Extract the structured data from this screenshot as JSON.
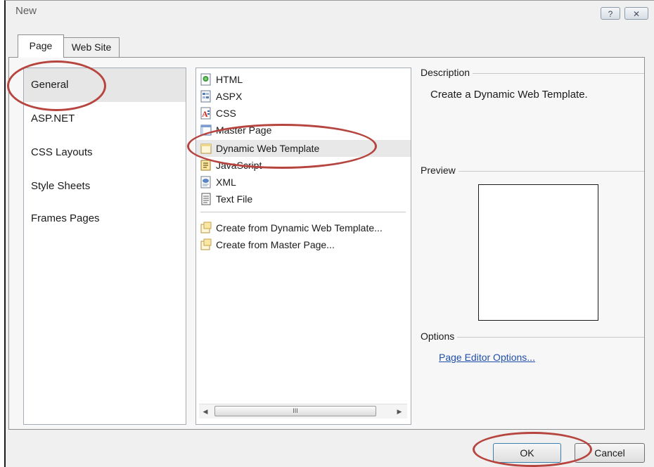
{
  "dialog": {
    "title": "New",
    "help_glyph": "?",
    "close_glyph": "✕"
  },
  "tabs": [
    {
      "label": "Page",
      "active": true
    },
    {
      "label": "Web Site",
      "active": false
    }
  ],
  "categories": [
    {
      "label": "General",
      "selected": true
    },
    {
      "label": "ASP.NET",
      "selected": false
    },
    {
      "label": "CSS Layouts",
      "selected": false
    },
    {
      "label": "Style Sheets",
      "selected": false
    },
    {
      "label": "Frames Pages",
      "selected": false
    }
  ],
  "templates": [
    {
      "label": "HTML",
      "icon": "html-file-icon"
    },
    {
      "label": "ASPX",
      "icon": "aspx-file-icon"
    },
    {
      "label": "CSS",
      "icon": "css-file-icon"
    },
    {
      "label": "Master Page",
      "icon": "master-page-icon"
    },
    {
      "label": "Dynamic Web Template",
      "icon": "dynamic-web-template-icon",
      "selected": true
    },
    {
      "label": "JavaScript",
      "icon": "javascript-file-icon"
    },
    {
      "label": "XML",
      "icon": "xml-file-icon"
    },
    {
      "label": "Text File",
      "icon": "text-file-icon"
    }
  ],
  "create_from": [
    {
      "label": "Create from Dynamic Web Template...",
      "icon": "create-from-template-icon"
    },
    {
      "label": "Create from Master Page...",
      "icon": "create-from-master-icon"
    }
  ],
  "scrollbar": {
    "left": "◀",
    "right": "▶",
    "grip": "III"
  },
  "description": {
    "heading": "Description",
    "text": "Create a Dynamic Web Template."
  },
  "preview": {
    "heading": "Preview"
  },
  "options": {
    "heading": "Options",
    "link": "Page Editor Options..."
  },
  "buttons": {
    "ok": "OK",
    "cancel": "Cancel"
  },
  "colors": {
    "annotation": "#b7453f",
    "link": "#1f4ea8",
    "selection": "#e6e6e6"
  }
}
